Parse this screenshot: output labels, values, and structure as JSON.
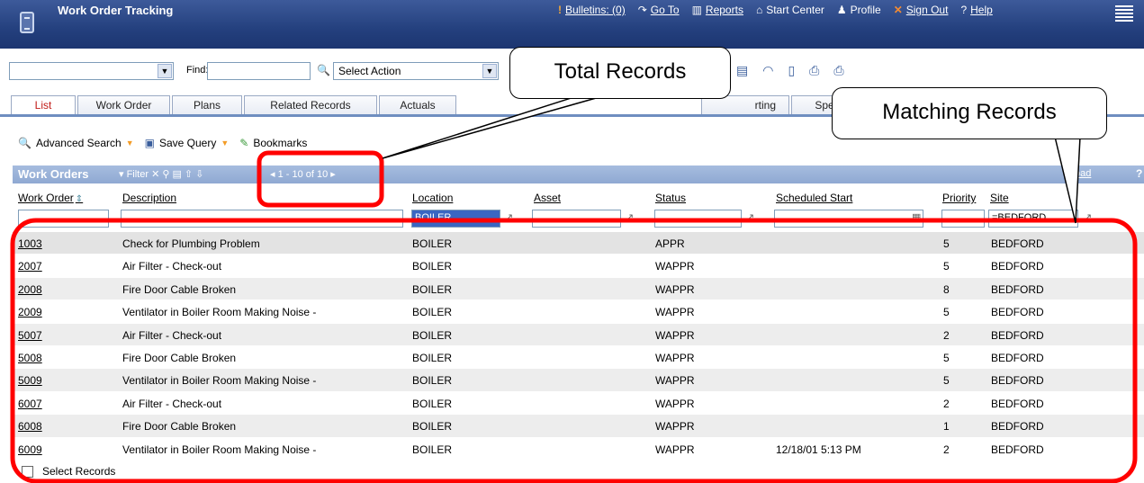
{
  "header": {
    "title": "Work Order Tracking",
    "nav": [
      {
        "icon": "bulletin-icon",
        "label": "Bulletins: (0)"
      },
      {
        "icon": "goto-icon",
        "label": "Go To"
      },
      {
        "icon": "reports-icon",
        "label": "Reports"
      },
      {
        "icon": "home-icon",
        "label": "Start Center"
      },
      {
        "icon": "profile-icon",
        "label": "Profile"
      },
      {
        "icon": "signout-icon",
        "label": "Sign Out"
      },
      {
        "icon": "help-icon",
        "label": "Help"
      }
    ]
  },
  "toolbar": {
    "find_label": "Find:",
    "action_select": "Select Action"
  },
  "tabs": [
    "List",
    "Work Order",
    "Plans",
    "Related Records",
    "Actuals",
    "rting",
    "Spec"
  ],
  "actions": {
    "advanced_search": "Advanced Search",
    "save_query": "Save Query",
    "bookmarks": "Bookmarks"
  },
  "table": {
    "title": "Work Orders",
    "filter": "Filter",
    "pager": "1 - 10 of 10",
    "download": "oad",
    "help": "?",
    "columns": [
      "Work Order",
      "Description",
      "Location",
      "Asset",
      "Status",
      "Scheduled Start",
      "Priority",
      "Site"
    ],
    "filters": {
      "location": "BOILER",
      "site": "=BEDFORD"
    },
    "rows": [
      {
        "wo": "1003",
        "desc": "Check for Plumbing Problem",
        "loc": "BOILER",
        "status": "APPR",
        "sched": "",
        "prio": "5",
        "site": "BEDFORD"
      },
      {
        "wo": "2007",
        "desc": "Air Filter - Check-out",
        "loc": "BOILER",
        "status": "WAPPR",
        "sched": "",
        "prio": "5",
        "site": "BEDFORD"
      },
      {
        "wo": "2008",
        "desc": "Fire Door Cable Broken",
        "loc": "BOILER",
        "status": "WAPPR",
        "sched": "",
        "prio": "8",
        "site": "BEDFORD"
      },
      {
        "wo": "2009",
        "desc": "Ventilator in Boiler Room Making Noise -",
        "loc": "BOILER",
        "status": "WAPPR",
        "sched": "",
        "prio": "5",
        "site": "BEDFORD"
      },
      {
        "wo": "5007",
        "desc": "Air Filter - Check-out",
        "loc": "BOILER",
        "status": "WAPPR",
        "sched": "",
        "prio": "2",
        "site": "BEDFORD"
      },
      {
        "wo": "5008",
        "desc": "Fire Door Cable Broken",
        "loc": "BOILER",
        "status": "WAPPR",
        "sched": "",
        "prio": "5",
        "site": "BEDFORD"
      },
      {
        "wo": "5009",
        "desc": "Ventilator in Boiler Room Making Noise -",
        "loc": "BOILER",
        "status": "WAPPR",
        "sched": "",
        "prio": "5",
        "site": "BEDFORD"
      },
      {
        "wo": "6007",
        "desc": "Air Filter - Check-out",
        "loc": "BOILER",
        "status": "WAPPR",
        "sched": "",
        "prio": "2",
        "site": "BEDFORD"
      },
      {
        "wo": "6008",
        "desc": "Fire Door Cable Broken",
        "loc": "BOILER",
        "status": "WAPPR",
        "sched": "",
        "prio": "1",
        "site": "BEDFORD"
      },
      {
        "wo": "6009",
        "desc": "Ventilator in Boiler Room Making Noise -",
        "loc": "BOILER",
        "status": "WAPPR",
        "sched": "12/18/01 5:13 PM",
        "prio": "2",
        "site": "BEDFORD"
      }
    ],
    "select_records": "Select Records"
  },
  "annotations": {
    "total_records": "Total Records",
    "matching_records": "Matching Records",
    "color": "#ff0000"
  }
}
